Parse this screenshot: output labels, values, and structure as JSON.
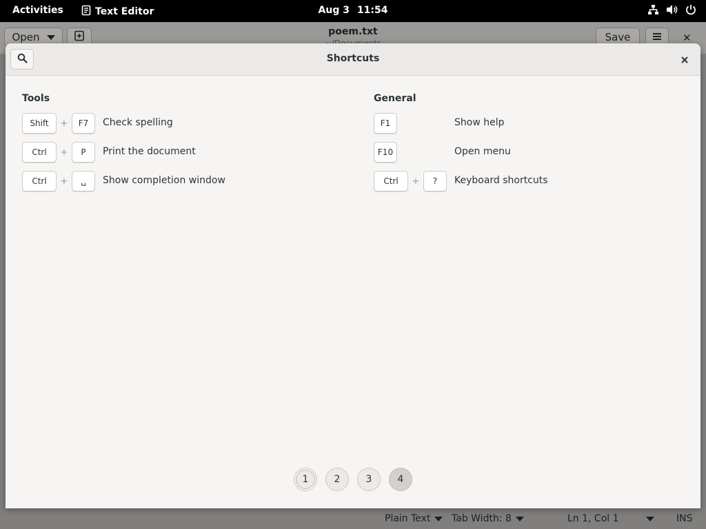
{
  "topbar": {
    "activities": "Activities",
    "app_name": "Text Editor",
    "date": "Aug 3",
    "time": "11:54",
    "icons": [
      "network-icon",
      "volume-icon",
      "power-icon"
    ]
  },
  "editor": {
    "open_label": "Open",
    "save_label": "Save",
    "file_title": "poem.txt",
    "file_subtitle": "~/Documents",
    "close_glyph": "✕",
    "statusbar": {
      "language": "Plain Text",
      "tab_width": "Tab Width: 8",
      "position": "Ln 1, Col 1",
      "mode": "INS"
    }
  },
  "dialog": {
    "title": "Shortcuts",
    "sections": [
      {
        "title": "Tools",
        "shortcuts": [
          {
            "keys": [
              "Shift",
              "F7"
            ],
            "description": "Check spelling"
          },
          {
            "keys": [
              "Ctrl",
              "P"
            ],
            "description": "Print the document"
          },
          {
            "keys": [
              "Ctrl",
              "␣"
            ],
            "description": "Show completion window"
          }
        ]
      },
      {
        "title": "General",
        "shortcuts": [
          {
            "keys": [
              "F1"
            ],
            "description": "Show help"
          },
          {
            "keys": [
              "F10"
            ],
            "description": "Open menu"
          },
          {
            "keys": [
              "Ctrl",
              "?"
            ],
            "description": "Keyboard shortcuts"
          }
        ]
      }
    ],
    "plus": "+",
    "pages": [
      "1",
      "2",
      "3",
      "4"
    ],
    "current_page": "4"
  },
  "colors": {
    "dialog_bg": "#f6f5f4",
    "topbar_bg": "#000000",
    "key_bg": "#ffffff",
    "active_page": "#d3d0cc"
  }
}
